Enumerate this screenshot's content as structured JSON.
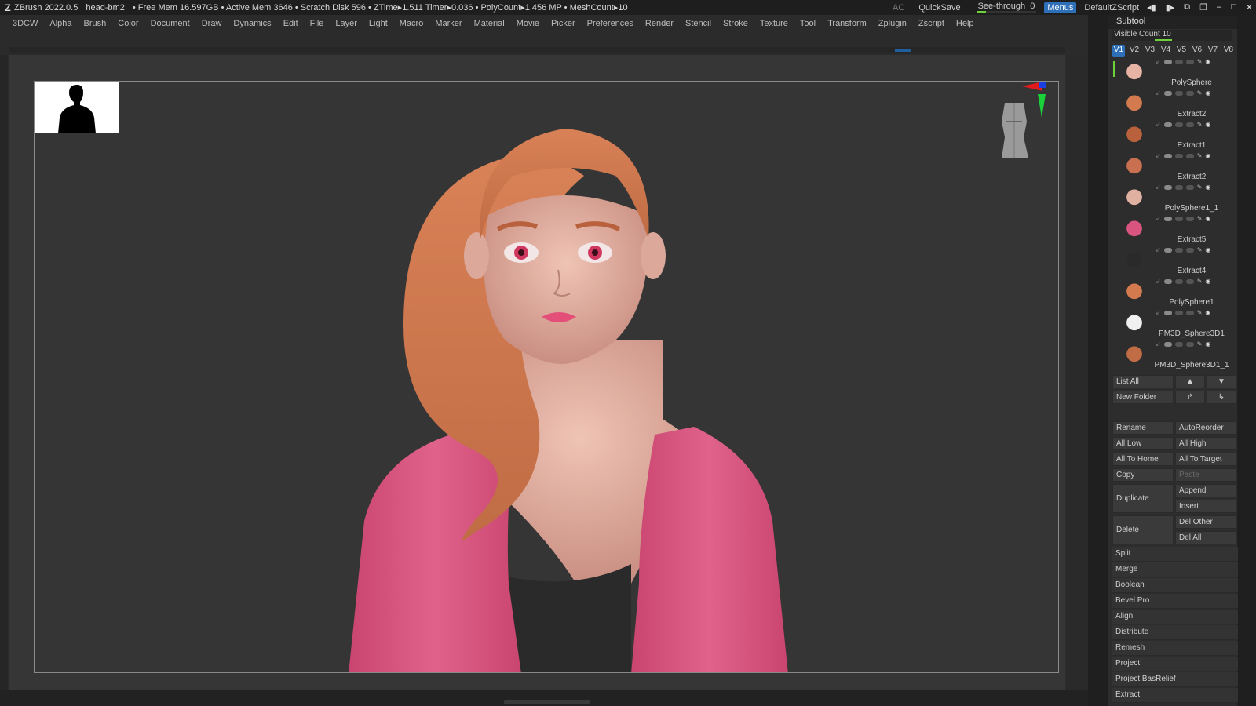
{
  "titlebar": {
    "app": "ZBrush 2022.0.5",
    "file": "head-bm2",
    "stats": "• Free Mem 16.597GB • Active Mem 3646 • Scratch Disk 596 • ZTime▸1.511 Timer▸0.036 • PolyCount▸1.456 MP • MeshCount▸10",
    "ac": "AC",
    "quicksave": "QuickSave",
    "seethrough": "See-through",
    "seethrough_value": "0",
    "menus": "Menus",
    "script": "DefaultZScript"
  },
  "menu": [
    "3DCW",
    "Alpha",
    "Brush",
    "Color",
    "Document",
    "Draw",
    "Dynamics",
    "Edit",
    "File",
    "Layer",
    "Light",
    "Macro",
    "Marker",
    "Material",
    "Movie",
    "Picker",
    "Preferences",
    "Render",
    "Stencil",
    "Stroke",
    "Texture",
    "Tool",
    "Transform",
    "Zplugin",
    "Zscript",
    "Help"
  ],
  "subtool_panel": {
    "title": "Subtool",
    "visible_count_label": "Visible Count",
    "visible_count": "10",
    "version_tabs": [
      "V1",
      "V2",
      "V3",
      "V4",
      "V5",
      "V6",
      "V7",
      "V8"
    ],
    "items": [
      {
        "name": "PolySphere"
      },
      {
        "name": "Extract2"
      },
      {
        "name": "Extract1"
      },
      {
        "name": "Extract2"
      },
      {
        "name": "PolySphere1_1"
      },
      {
        "name": "Extract5"
      },
      {
        "name": "Extract4"
      },
      {
        "name": "PolySphere1"
      },
      {
        "name": "PM3D_Sphere3D1"
      },
      {
        "name": "PM3D_Sphere3D1_1"
      }
    ],
    "list_all": "List All",
    "new_folder": "New Folder",
    "rename": "Rename",
    "auto_reorder": "AutoReorder",
    "all_low": "All Low",
    "all_high": "All High",
    "all_to_home": "All To Home",
    "all_to_target": "All To Target",
    "copy": "Copy",
    "paste": "Paste",
    "duplicate": "Duplicate",
    "append": "Append",
    "insert": "Insert",
    "delete": "Delete",
    "del_other": "Del Other",
    "del_all": "Del All",
    "sections": [
      "Split",
      "Merge",
      "Boolean",
      "Bevel Pro",
      "Align",
      "Distribute",
      "Remesh",
      "Project",
      "Project BasRelief",
      "Extract"
    ]
  },
  "colors": {
    "accent": "#2d6fb8",
    "hair": "#d37a4f",
    "jacket": "#d9547e",
    "skin": "#e6b3a4"
  }
}
